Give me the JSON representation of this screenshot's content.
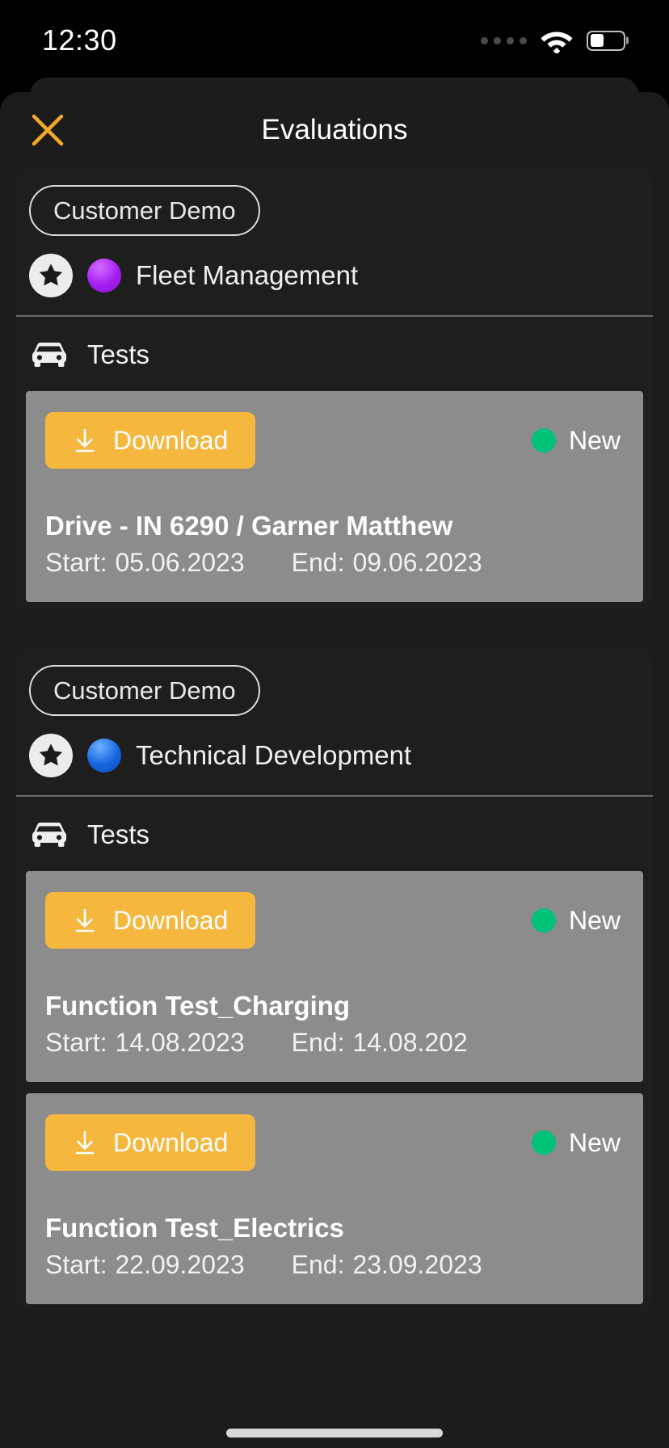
{
  "statusbar": {
    "time": "12:30",
    "signal_icon": "signal-dots-icon",
    "wifi_icon": "wifi-icon",
    "battery_icon": "battery-icon",
    "battery_level_pct": 42
  },
  "sheet": {
    "title": "Evaluations",
    "close_icon": "close-icon",
    "close_color": "#f0a92b"
  },
  "colors": {
    "accent_orange": "#f5b73e",
    "status_green": "#00c278",
    "card_grey": "#8c8c8c",
    "sheet_bg": "#1c1c1c",
    "group_bg": "#1e1e1e"
  },
  "groups": [
    {
      "pill_label": "Customer Demo",
      "star_icon": "star-icon",
      "category_dot_color": "#a31ef0",
      "category_label": "Fleet Management",
      "section_icon": "car-icon",
      "section_label": "Tests",
      "cards": [
        {
          "download_label": "Download",
          "download_icon": "download-icon",
          "status_label": "New",
          "status_color": "#00c278",
          "title": "Drive - IN 6290 / Garner Matthew",
          "start_label": "Start:",
          "start_value": "05.06.2023",
          "end_label": "End:",
          "end_value": "09.06.2023"
        }
      ]
    },
    {
      "pill_label": "Customer Demo",
      "star_icon": "star-icon",
      "category_dot_color": "#1565e0",
      "category_label": "Technical Development",
      "section_icon": "car-icon",
      "section_label": "Tests",
      "cards": [
        {
          "download_label": "Download",
          "download_icon": "download-icon",
          "status_label": "New",
          "status_color": "#00c278",
          "title": "Function Test_Charging",
          "start_label": "Start:",
          "start_value": "14.08.2023",
          "end_label": "End:",
          "end_value": "14.08.202"
        },
        {
          "download_label": "Download",
          "download_icon": "download-icon",
          "status_label": "New",
          "status_color": "#00c278",
          "title": "Function Test_Electrics",
          "start_label": "Start:",
          "start_value": "22.09.2023",
          "end_label": "End:",
          "end_value": "23.09.2023"
        }
      ]
    }
  ]
}
